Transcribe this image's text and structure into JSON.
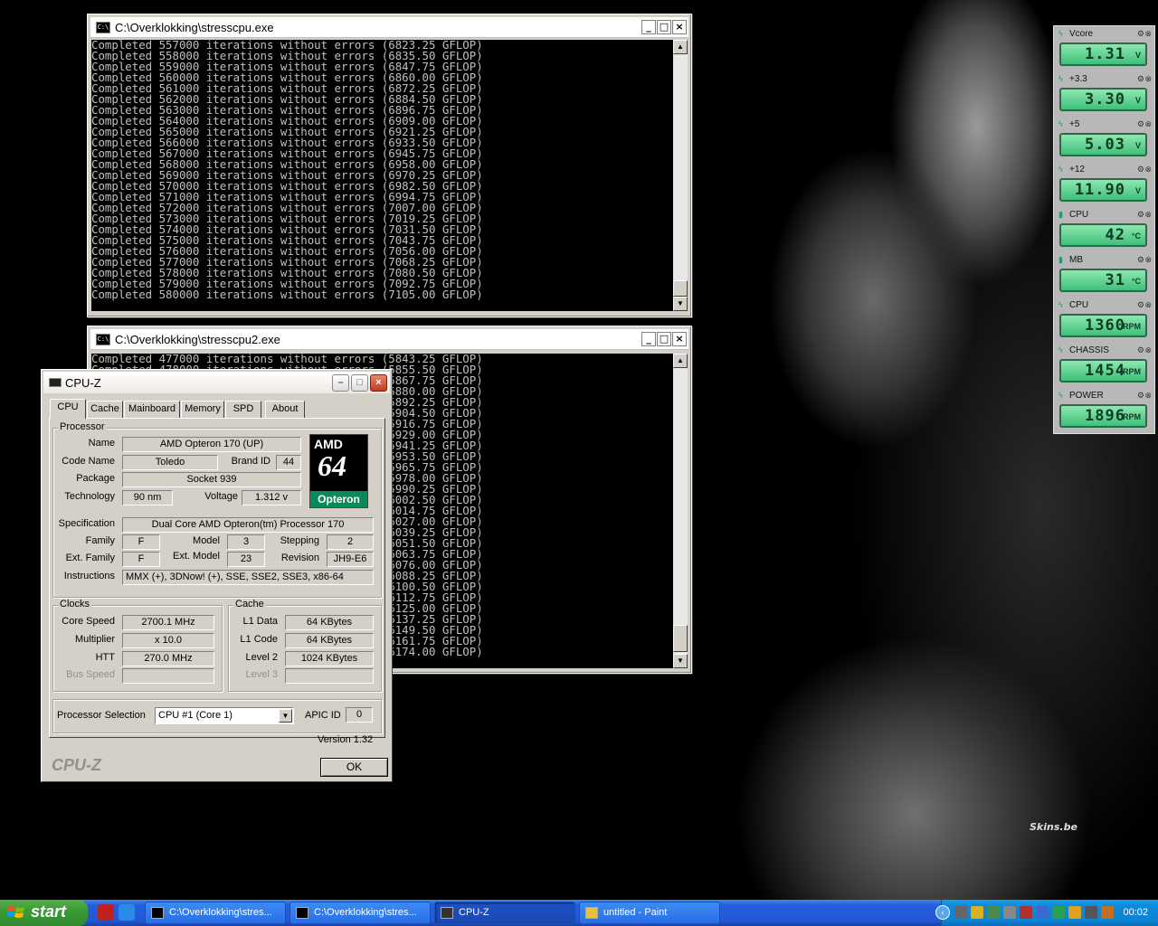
{
  "desktop": {
    "watermark": "Skins.be"
  },
  "console1": {
    "title": "C:\\Overklokking\\stresscpu.exe",
    "lines": [
      "Completed 557000 iterations without errors (6823.25 GFLOP)",
      "Completed 558000 iterations without errors (6835.50 GFLOP)",
      "Completed 559000 iterations without errors (6847.75 GFLOP)",
      "Completed 560000 iterations without errors (6860.00 GFLOP)",
      "Completed 561000 iterations without errors (6872.25 GFLOP)",
      "Completed 562000 iterations without errors (6884.50 GFLOP)",
      "Completed 563000 iterations without errors (6896.75 GFLOP)",
      "Completed 564000 iterations without errors (6909.00 GFLOP)",
      "Completed 565000 iterations without errors (6921.25 GFLOP)",
      "Completed 566000 iterations without errors (6933.50 GFLOP)",
      "Completed 567000 iterations without errors (6945.75 GFLOP)",
      "Completed 568000 iterations without errors (6958.00 GFLOP)",
      "Completed 569000 iterations without errors (6970.25 GFLOP)",
      "Completed 570000 iterations without errors (6982.50 GFLOP)",
      "Completed 571000 iterations without errors (6994.75 GFLOP)",
      "Completed 572000 iterations without errors (7007.00 GFLOP)",
      "Completed 573000 iterations without errors (7019.25 GFLOP)",
      "Completed 574000 iterations without errors (7031.50 GFLOP)",
      "Completed 575000 iterations without errors (7043.75 GFLOP)",
      "Completed 576000 iterations without errors (7056.00 GFLOP)",
      "Completed 577000 iterations without errors (7068.25 GFLOP)",
      "Completed 578000 iterations without errors (7080.50 GFLOP)",
      "Completed 579000 iterations without errors (7092.75 GFLOP)",
      "Completed 580000 iterations without errors (7105.00 GFLOP)"
    ]
  },
  "console2": {
    "title": "C:\\Overklokking\\stresscpu2.exe",
    "lines": [
      "Completed 477000 iterations without errors (5843.25 GFLOP)",
      "Completed 478000 iterations without errors (5855.50 GFLOP)",
      "Completed 479000 iterations without errors (5867.75 GFLOP)",
      "Completed 480000 iterations without errors (5880.00 GFLOP)",
      "Completed 481000 iterations without errors (5892.25 GFLOP)",
      "Completed 482000 iterations without errors (5904.50 GFLOP)",
      "Completed 483000 iterations without errors (5916.75 GFLOP)",
      "Completed 484000 iterations without errors (5929.00 GFLOP)",
      "Completed 485000 iterations without errors (5941.25 GFLOP)",
      "Completed 486000 iterations without errors (5953.50 GFLOP)",
      "Completed 487000 iterations without errors (5965.75 GFLOP)",
      "Completed 488000 iterations without errors (5978.00 GFLOP)",
      "Completed 489000 iterations without errors (5990.25 GFLOP)",
      "Completed 490000 iterations without errors (6002.50 GFLOP)",
      "Completed 491000 iterations without errors (6014.75 GFLOP)",
      "Completed 492000 iterations without errors (6027.00 GFLOP)",
      "Completed 493000 iterations without errors (6039.25 GFLOP)",
      "Completed 494000 iterations without errors (6051.50 GFLOP)",
      "Completed 495000 iterations without errors (6063.75 GFLOP)",
      "Completed 496000 iterations without errors (6076.00 GFLOP)",
      "Completed 497000 iterations without errors (6088.25 GFLOP)",
      "Completed 498000 iterations without errors (6100.50 GFLOP)",
      "Completed 499000 iterations without errors (6112.75 GFLOP)",
      "Completed 500000 iterations without errors (6125.00 GFLOP)",
      "Completed 501000 iterations without errors (6137.25 GFLOP)",
      "Completed 502000 iterations without errors (6149.50 GFLOP)",
      "Completed 503000 iterations without errors (6161.75 GFLOP)",
      "Completed 504000 iterations without errors (6174.00 GFLOP)"
    ]
  },
  "cpuz": {
    "title": "CPU-Z",
    "tabs": [
      "CPU",
      "Cache",
      "Mainboard",
      "Memory",
      "SPD",
      "About"
    ],
    "processor": {
      "group": "Processor",
      "name_label": "Name",
      "name": "AMD Opteron 170 (UP)",
      "codename_label": "Code Name",
      "codename": "Toledo",
      "brandid_label": "Brand ID",
      "brandid": "44",
      "package_label": "Package",
      "package": "Socket 939",
      "technology_label": "Technology",
      "technology": "90 nm",
      "voltage_label": "Voltage",
      "voltage": "1.312 v",
      "spec_label": "Specification",
      "spec": "Dual Core AMD Opteron(tm) Processor 170",
      "family_label": "Family",
      "family": "F",
      "model_label": "Model",
      "model": "3",
      "stepping_label": "Stepping",
      "stepping": "2",
      "extfamily_label": "Ext. Family",
      "extfamily": "F",
      "extmodel_label": "Ext. Model",
      "extmodel": "23",
      "revision_label": "Revision",
      "revision": "JH9-E6",
      "instructions_label": "Instructions",
      "instructions": "MMX (+), 3DNow! (+), SSE, SSE2, SSE3, x86-64",
      "logo_amd": "AMD",
      "logo_64": "64",
      "logo_brand": "Opteron"
    },
    "clocks": {
      "group": "Clocks",
      "corespeed_label": "Core Speed",
      "corespeed": "2700.1 MHz",
      "multiplier_label": "Multiplier",
      "multiplier": "x 10.0",
      "htt_label": "HTT",
      "htt": "270.0 MHz",
      "busspeed_label": "Bus Speed",
      "busspeed": ""
    },
    "cache": {
      "group": "Cache",
      "l1data_label": "L1 Data",
      "l1data": "64 KBytes",
      "l1code_label": "L1 Code",
      "l1code": "64 KBytes",
      "level2_label": "Level 2",
      "level2": "1024 KBytes",
      "level3_label": "Level 3",
      "level3": ""
    },
    "selection_label": "Processor Selection",
    "selection_value": "CPU #1 (Core 1)",
    "apic_label": "APIC ID",
    "apic_value": "0",
    "version": "Version 1.32",
    "footer_brand": "CPU-Z",
    "ok_label": "OK"
  },
  "gadgets": [
    {
      "name": "Vcore",
      "value": "1.31",
      "unit": "V",
      "icon": "bolt-icon"
    },
    {
      "name": "+3.3",
      "value": "3.30",
      "unit": "V",
      "icon": "bolt-icon"
    },
    {
      "name": "+5",
      "value": "5.03",
      "unit": "V",
      "icon": "bolt-icon"
    },
    {
      "name": "+12",
      "value": "11.90",
      "unit": "V",
      "icon": "bolt-icon"
    },
    {
      "name": "CPU",
      "value": "42",
      "unit": "°C",
      "icon": "thermometer-icon"
    },
    {
      "name": "MB",
      "value": "31",
      "unit": "°C",
      "icon": "thermometer-icon"
    },
    {
      "name": "CPU",
      "value": "1360",
      "unit": "RPM",
      "icon": "fan-icon"
    },
    {
      "name": "CHASSIS",
      "value": "1454",
      "unit": "RPM",
      "icon": "fan-icon"
    },
    {
      "name": "POWER",
      "value": "1896",
      "unit": "RPM",
      "icon": "fan-icon"
    }
  ],
  "taskbar": {
    "start_label": "start",
    "tasks": [
      {
        "label": "C:\\Overklokking\\stres...",
        "active": false
      },
      {
        "label": "C:\\Overklokking\\stres...",
        "active": false
      },
      {
        "label": "CPU-Z",
        "active": true
      },
      {
        "label": "untitled - Paint",
        "active": false
      }
    ],
    "clock": "00:02"
  }
}
